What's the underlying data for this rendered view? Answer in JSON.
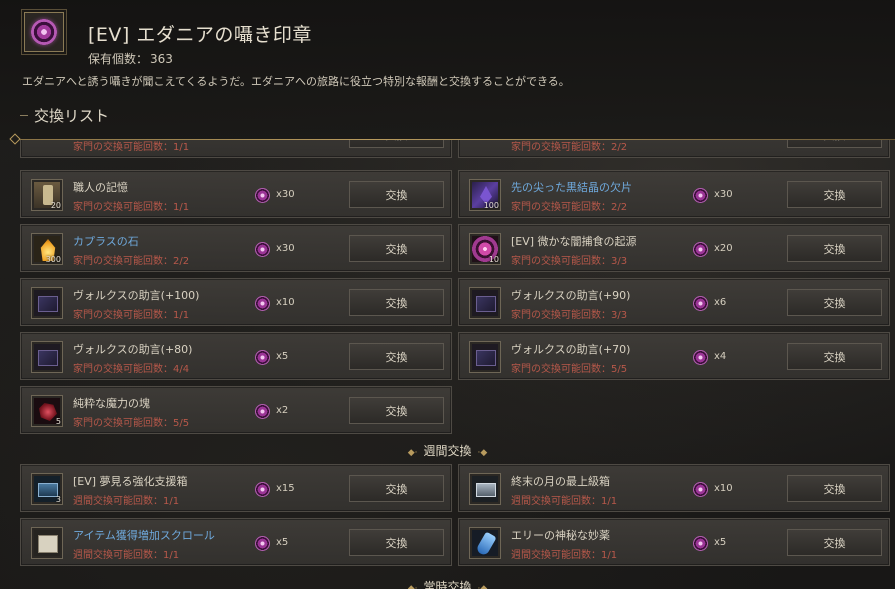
{
  "header": {
    "title": "[EV] エダニアの囁き印章",
    "owned_label": "保有個数：",
    "owned_count": "363",
    "description": "エダニアへと誘う囁きが聞こえてくるようだ。エダニアへの旅路に役立つ特別な報酬と交換することができる。"
  },
  "list_title": "交換リスト",
  "exchange_label": "交換",
  "partial_top": [
    {
      "limit": "家門の交換可能回数：1/1"
    },
    {
      "limit": "家門の交換可能回数：2/2"
    }
  ],
  "family_items": [
    {
      "name": "職人の記憶",
      "name_color": "normal",
      "limit": "家門の交換可能回数：1/1",
      "cost": "x30",
      "icon": "scroll-icon",
      "count": "20"
    },
    {
      "name": "先の尖った黒結晶の欠片",
      "name_color": "blue",
      "limit": "家門の交換可能回数：2/2",
      "cost": "x30",
      "icon": "black-crystal-icon",
      "count": "100"
    },
    {
      "name": "カプラスの石",
      "name_color": "blue",
      "limit": "家門の交換可能回数：2/2",
      "cost": "x30",
      "icon": "caphras-stone-icon",
      "count": "300"
    },
    {
      "name": "[EV] 微かな闇捕食の起源",
      "name_color": "normal",
      "limit": "家門の交換可能回数：3/3",
      "cost": "x20",
      "icon": "vortex-icon",
      "count": "10"
    },
    {
      "name": "ヴォルクスの助言(+100)",
      "name_color": "normal",
      "limit": "家門の交換可能回数：1/1",
      "cost": "x10",
      "icon": "book-icon",
      "count": ""
    },
    {
      "name": "ヴォルクスの助言(+90)",
      "name_color": "normal",
      "limit": "家門の交換可能回数：3/3",
      "cost": "x6",
      "icon": "book-icon",
      "count": ""
    },
    {
      "name": "ヴォルクスの助言(+80)",
      "name_color": "normal",
      "limit": "家門の交換可能回数：4/4",
      "cost": "x5",
      "icon": "book-icon",
      "count": ""
    },
    {
      "name": "ヴォルクスの助言(+70)",
      "name_color": "normal",
      "limit": "家門の交換可能回数：5/5",
      "cost": "x4",
      "icon": "book-icon",
      "count": ""
    },
    {
      "name": "純粋な魔力の塊",
      "name_color": "normal",
      "limit": "家門の交換可能回数：5/5",
      "cost": "x2",
      "icon": "magic-crystal-icon",
      "count": "5"
    }
  ],
  "weekly_section_label": "週間交換",
  "weekly_items": [
    {
      "name": "[EV] 夢見る強化支援箱",
      "name_color": "normal",
      "limit": "週間交換可能回数：1/1",
      "cost": "x15",
      "icon": "chest-icon",
      "count": "3"
    },
    {
      "name": "終末の月の最上級箱",
      "name_color": "normal",
      "limit": "週間交換可能回数：1/1",
      "cost": "x10",
      "icon": "box-icon",
      "count": ""
    },
    {
      "name": "アイテム獲得増加スクロール",
      "name_color": "blue",
      "limit": "週間交換可能回数：1/1",
      "cost": "x5",
      "icon": "item-scroll-icon",
      "count": ""
    },
    {
      "name": "エリーの神秘な妙薬",
      "name_color": "normal",
      "limit": "週間交換可能回数：1/1",
      "cost": "x5",
      "icon": "elixir-icon",
      "count": ""
    }
  ],
  "permanent_section_label": "常時交換",
  "colors": {
    "limit_red": "#b7584a",
    "name_blue": "#6fa9dc",
    "gold_accent": "#b89b5e"
  }
}
